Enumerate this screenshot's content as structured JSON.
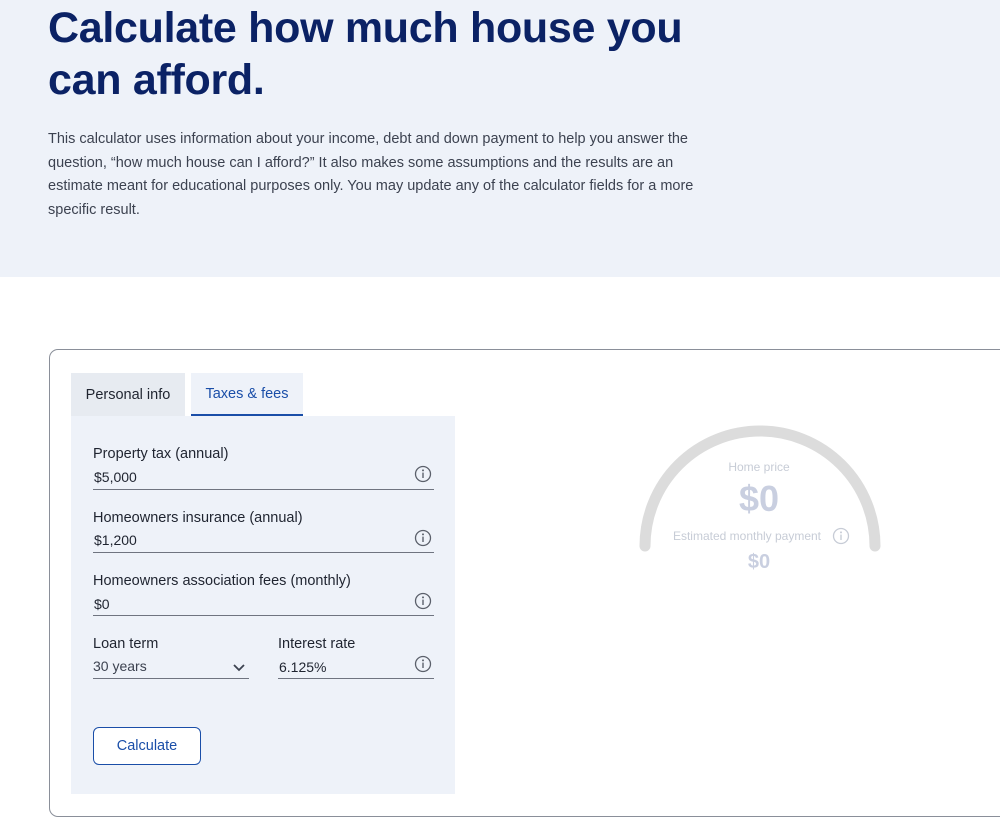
{
  "hero": {
    "title": "Calculate how much house you can afford.",
    "description": "This calculator uses information about your income, debt and down payment to help you answer the question, “how much house can I afford?” It also makes some assumptions and the results are an estimate meant for educational purposes only. You may update any of the calculator fields for a more specific result."
  },
  "tabs": [
    {
      "label": "Personal info",
      "active": false
    },
    {
      "label": "Taxes & fees",
      "active": true
    }
  ],
  "fields": {
    "property_tax": {
      "label": "Property tax (annual)",
      "value": "$5,000"
    },
    "insurance": {
      "label": "Homeowners insurance (annual)",
      "value": "$1,200"
    },
    "hoa": {
      "label": "Homeowners association fees (monthly)",
      "value": "$0"
    },
    "loan_term": {
      "label": "Loan term",
      "value": "30 years"
    },
    "interest_rate": {
      "label": "Interest rate",
      "value": "6.125%"
    }
  },
  "calculate_label": "Calculate",
  "results": {
    "home_price_label": "Home price",
    "home_price_value": "$0",
    "monthly_label": "Estimated monthly payment",
    "monthly_value": "$0"
  },
  "icons": {
    "info": "info-icon",
    "chevron": "chevron-down-icon"
  },
  "colors": {
    "brand": "#0b2265",
    "accent": "#1a4ea8",
    "hero_bg": "#eef2f9",
    "gauge_track": "#dcdcdc"
  }
}
